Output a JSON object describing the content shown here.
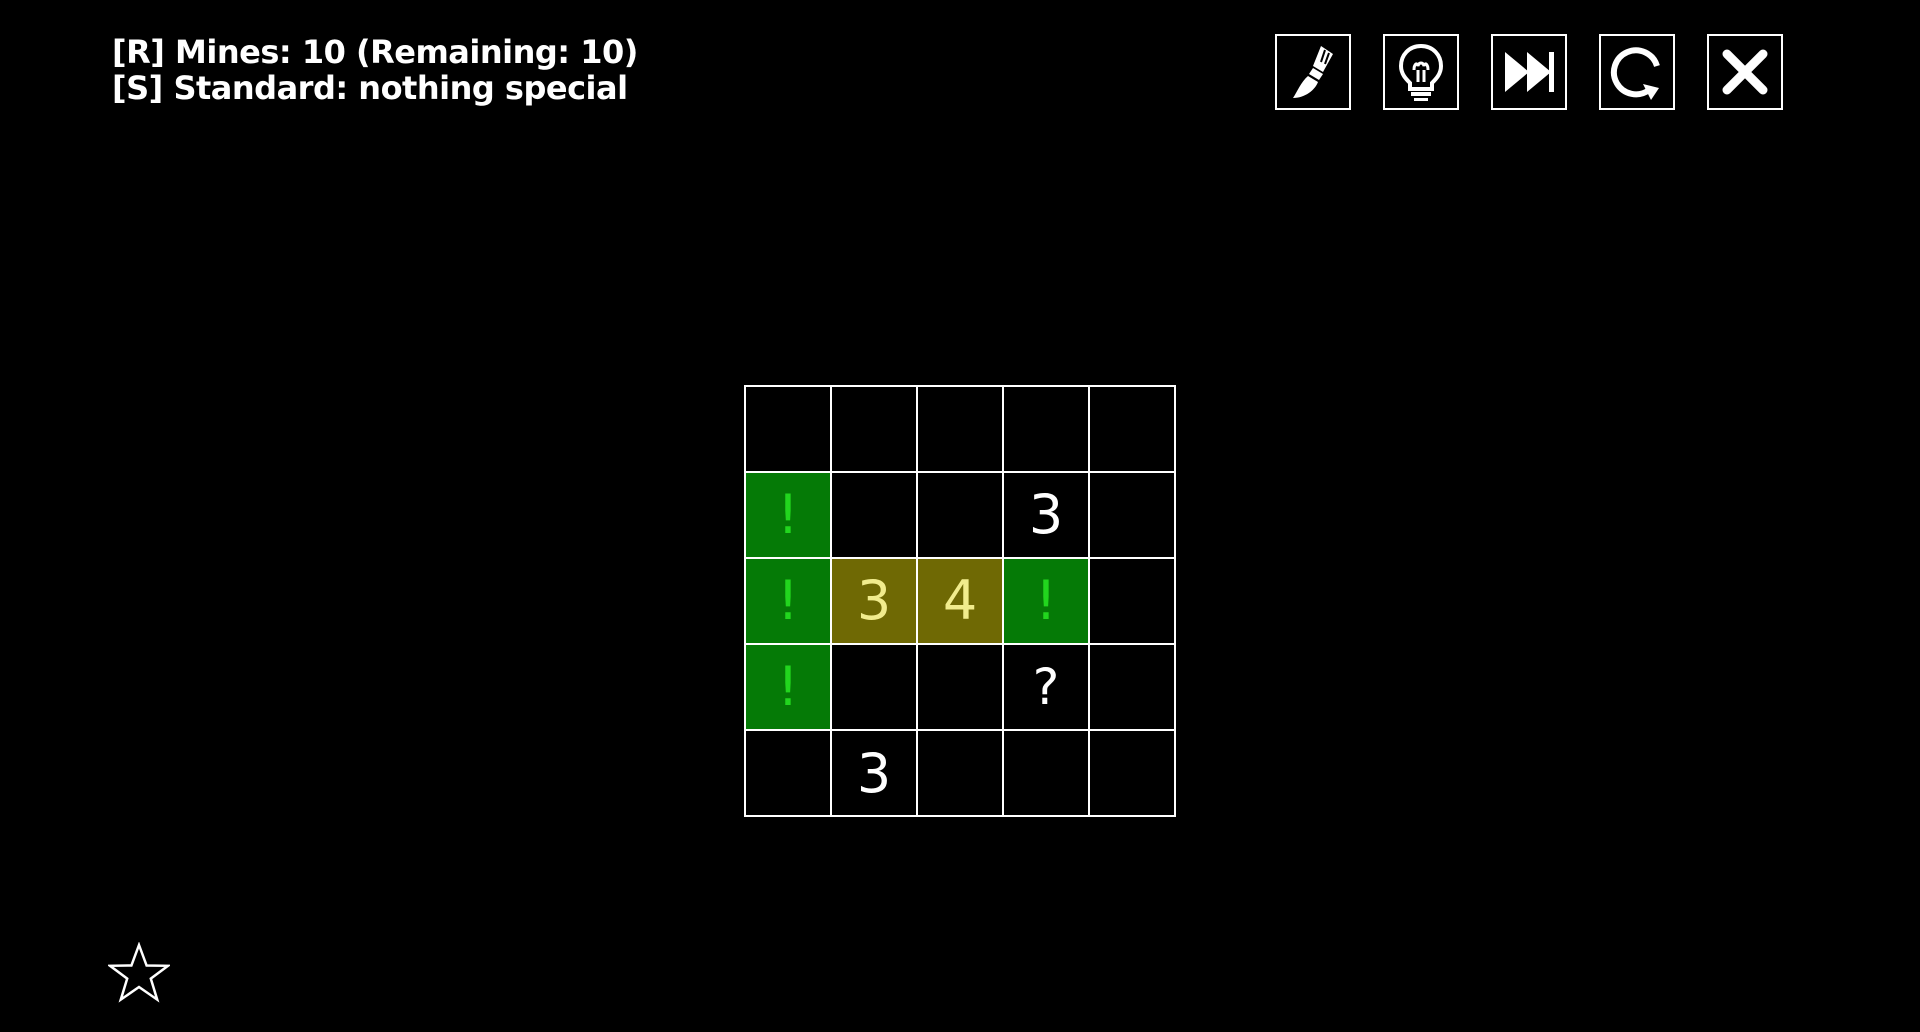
{
  "header": {
    "line1": "[R] Mines: 10 (Remaining: 10)",
    "line2": "[S] Standard: nothing special"
  },
  "toolbar": [
    {
      "icon": "paintbrush-icon",
      "name": "brush-button"
    },
    {
      "icon": "lightbulb-icon",
      "name": "hint-button"
    },
    {
      "icon": "fast-forward-icon",
      "name": "skip-button"
    },
    {
      "icon": "restart-icon",
      "name": "restart-button"
    },
    {
      "icon": "close-icon",
      "name": "close-button"
    }
  ],
  "board": {
    "rows": 5,
    "cols": 5,
    "cells": [
      [
        "",
        "",
        "",
        "",
        ""
      ],
      [
        "!",
        "",
        "",
        "3",
        ""
      ],
      [
        "!",
        "3",
        "4",
        "!",
        ""
      ],
      [
        "!",
        "",
        "",
        "?",
        ""
      ],
      [
        "",
        "3",
        "",
        "",
        ""
      ]
    ],
    "highlight": [
      [
        "none",
        "none",
        "none",
        "none",
        "none"
      ],
      [
        "green",
        "none",
        "none",
        "none",
        "none"
      ],
      [
        "green",
        "yellow",
        "yellow",
        "green",
        "none"
      ],
      [
        "green",
        "none",
        "none",
        "none",
        "none"
      ],
      [
        "none",
        "none",
        "none",
        "none",
        "none"
      ]
    ]
  },
  "colors": {
    "background": "#000000",
    "grid": "#ffffff",
    "flag_bg": "#057a06",
    "flag_text": "#22d61e",
    "hint_bg": "#6f6904",
    "hint_text": "#f1ec8d"
  },
  "footer": {
    "icon": "star-outline-icon"
  }
}
